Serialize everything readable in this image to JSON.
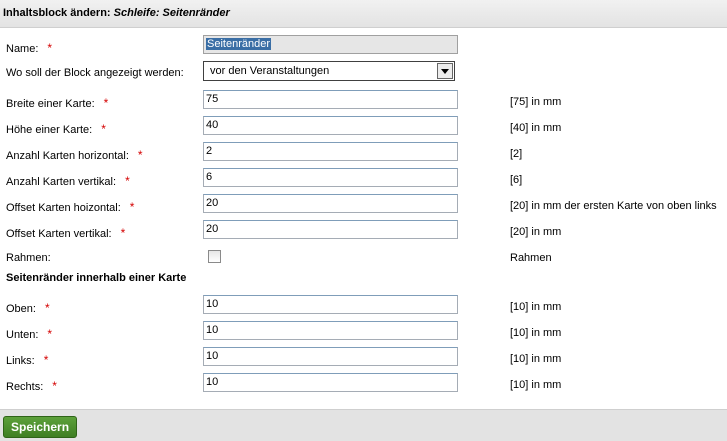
{
  "header": {
    "title_prefix": "Inhaltsblock ändern:",
    "title_name": "Schleife: Seitenränder"
  },
  "fields": [
    {
      "label": "Name:",
      "required": true,
      "value": "Seitenränder",
      "hint": ""
    },
    {
      "label": "Wo soll der Block angezeigt werden:",
      "required": false,
      "value": "vor den Veranstaltungen",
      "hint": ""
    },
    {
      "label": "Breite einer Karte:",
      "required": true,
      "value": "75",
      "hint": "[75] in mm"
    },
    {
      "label": "Höhe einer Karte:",
      "required": true,
      "value": "40",
      "hint": "[40] in mm"
    },
    {
      "label": "Anzahl Karten horizontal:",
      "required": true,
      "value": "2",
      "hint": "[2]"
    },
    {
      "label": "Anzahl Karten vertikal:",
      "required": true,
      "value": "6",
      "hint": "[6]"
    },
    {
      "label": "Offset Karten hoizontal:",
      "required": true,
      "value": "20",
      "hint": "[20] in mm der ersten Karte von oben links"
    },
    {
      "label": "Offset Karten vertikal:",
      "required": true,
      "value": "20",
      "hint": "[20] in mm"
    },
    {
      "label": "Rahmen:",
      "required": false,
      "checked": false,
      "hint": "Rahmen"
    }
  ],
  "section": {
    "title": "Seitenränder innerhalb einer Karte"
  },
  "margins": [
    {
      "label": "Oben:",
      "required": true,
      "value": "10",
      "hint": "[10] in mm"
    },
    {
      "label": "Unten:",
      "required": true,
      "value": "10",
      "hint": "[10] in mm"
    },
    {
      "label": "Links:",
      "required": true,
      "value": "10",
      "hint": "[10] in mm"
    },
    {
      "label": "Rechts:",
      "required": true,
      "value": "10",
      "hint": "[10] in mm"
    }
  ],
  "required_marker": "*",
  "footer": {
    "save_label": "Speichern"
  },
  "colors": {
    "required": "#d40000",
    "button": "#4a8a2c"
  }
}
